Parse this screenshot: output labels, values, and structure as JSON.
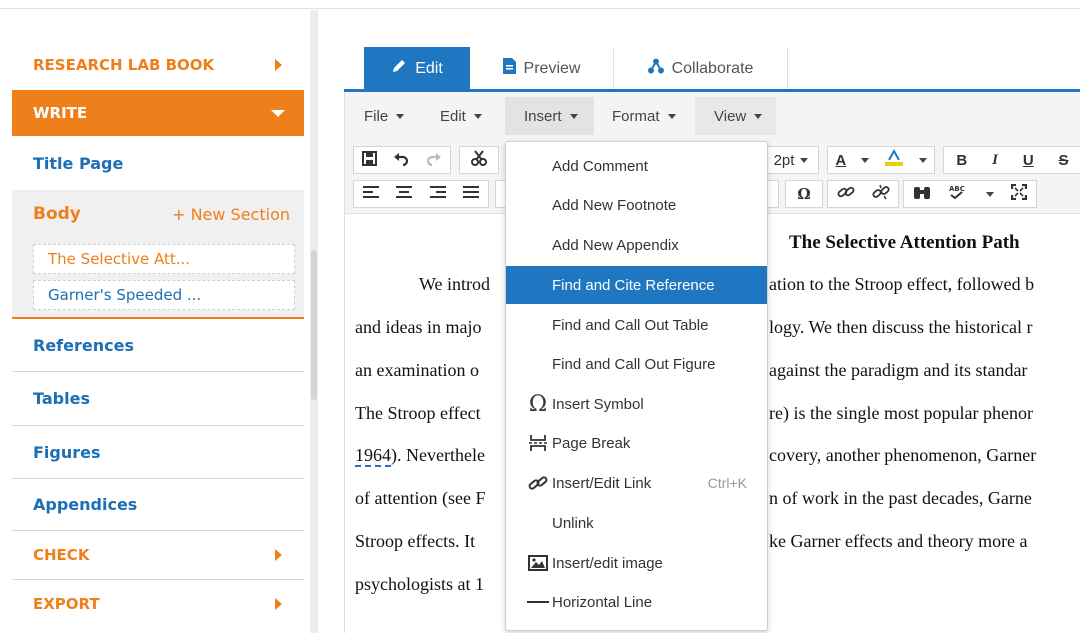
{
  "sidebar": {
    "research_lab_book": "RESEARCH LAB BOOK",
    "write": "WRITE",
    "title_page": "Title Page",
    "body": "Body",
    "new_section": "+ New Section",
    "sections": [
      "The Selective Att...",
      "Garner's Speeded ..."
    ],
    "references": "References",
    "tables": "Tables",
    "figures": "Figures",
    "appendices": "Appendices",
    "check": "CHECK",
    "export": "EXPORT"
  },
  "tabs": {
    "edit": "Edit",
    "preview": "Preview",
    "collaborate": "Collaborate"
  },
  "menubar": {
    "file": "File",
    "edit": "Edit",
    "insert": "Insert",
    "format": "Format",
    "view": "View"
  },
  "toolbar": {
    "font_size": "2pt",
    "text_color_glyph": "A",
    "bold": "B",
    "italic": "I",
    "underline": "U",
    "strike": "S",
    "omega": "Ω"
  },
  "insert_menu": {
    "add_comment": "Add Comment",
    "add_footnote": "Add New Footnote",
    "add_appendix": "Add New Appendix",
    "find_cite": "Find and Cite Reference",
    "find_table": "Find and Call Out Table",
    "find_figure": "Find and Call Out Figure",
    "insert_symbol": "Insert Symbol",
    "page_break": "Page Break",
    "insert_link": "Insert/Edit Link",
    "insert_link_shortcut": "Ctrl+K",
    "unlink": "Unlink",
    "insert_image": "Insert/edit image",
    "horizontal_line": "Horizontal Line"
  },
  "document": {
    "title": "The Selective Attention Path",
    "line1_a": "We introd",
    "line1_b": "ation to the Stroop effect, followed b",
    "line2_a": "and ideas in majo",
    "line2_b": "logy. We then discuss the historical r",
    "line3_a": "an examination o",
    "line3_b": "against the paradigm and its standar",
    "line4_a": "The Stroop effect",
    "line4_b": "re) is the single most popular phenor",
    "line5_a": "1964",
    "line5_a2": "). Neverthele",
    "line5_b": "covery, another phenomenon, Garner",
    "line6_a": "of attention (see F",
    "line6_b": "n of work in the past decades, Garne",
    "line7_a": "Stroop effects. It",
    "line7_b": "ke Garner effects and theory more a",
    "line8_a": "psychologists at 1"
  },
  "colors": {
    "accent_orange": "#ef7f1a",
    "accent_blue": "#1f77c2",
    "link_blue": "#1c6fb5"
  }
}
